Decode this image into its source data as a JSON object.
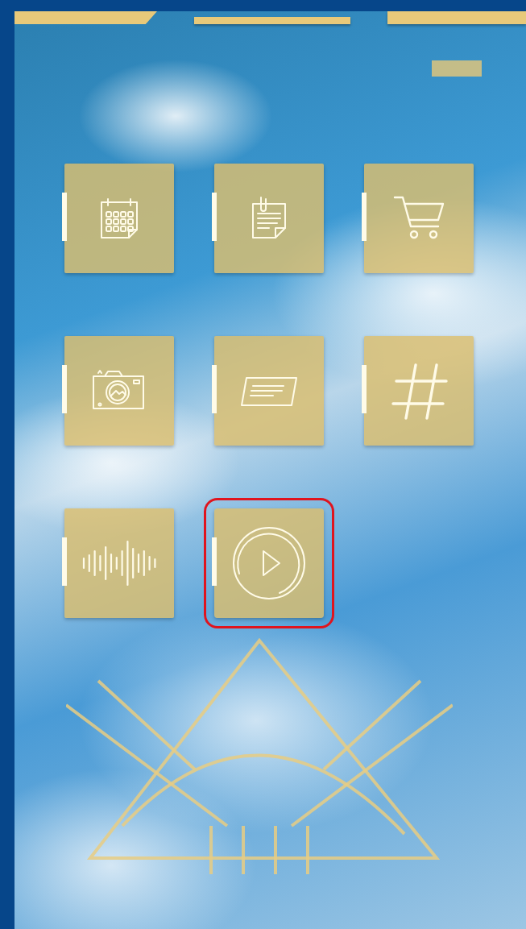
{
  "apps": [
    {
      "kind": "calendar",
      "selected": false
    },
    {
      "kind": "notes",
      "selected": false
    },
    {
      "kind": "cart",
      "selected": false
    },
    {
      "kind": "camera",
      "selected": false
    },
    {
      "kind": "card",
      "selected": false
    },
    {
      "kind": "hash",
      "selected": false
    },
    {
      "kind": "waveform",
      "selected": false
    },
    {
      "kind": "play",
      "selected": true
    }
  ]
}
